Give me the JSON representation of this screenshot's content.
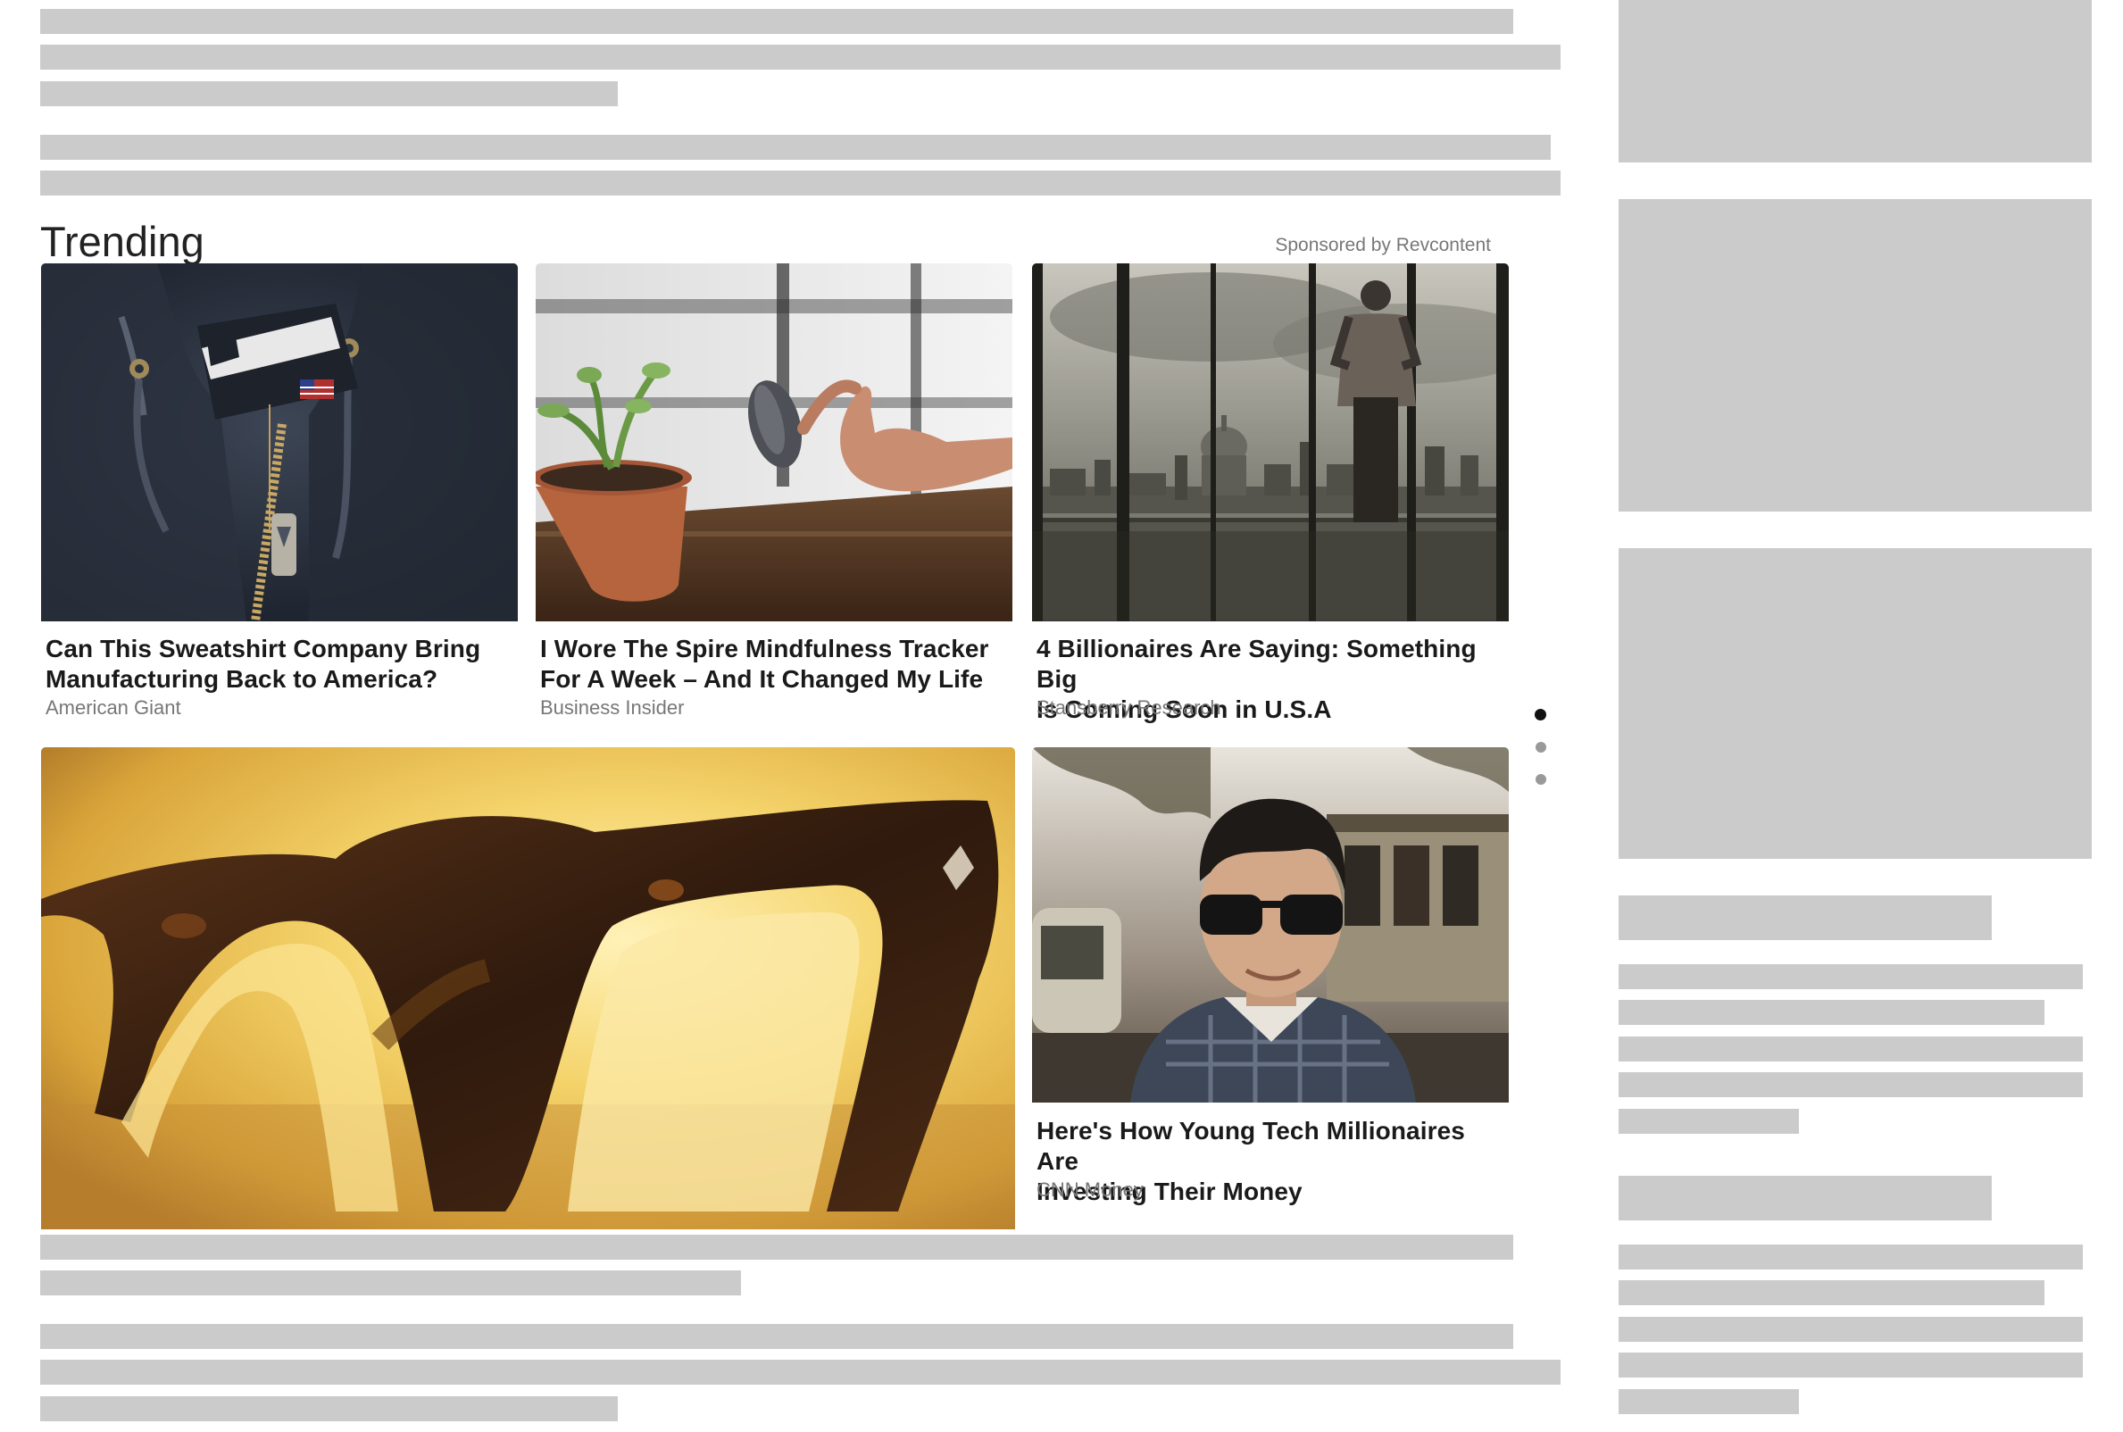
{
  "widget": {
    "title": "Trending",
    "sponsored_label": "Sponsored by Revcontent"
  },
  "cards": [
    {
      "headline_line1": "Can This Sweatshirt Company Bring",
      "headline_line2": "Manufacturing Back to America?",
      "source": "American Giant",
      "image": "sweatshirt-photo"
    },
    {
      "headline_line1": "I Wore The Spire Mindfulness Tracker",
      "headline_line2": "For A Week – And It Changed My Life",
      "source": "Business Insider",
      "image": "tracker-photo"
    },
    {
      "headline_line1": "4 Billionaires Are Saying: Something Big",
      "headline_line2": "Is Coming Soon in U.S.A",
      "source": "Stansberry Research",
      "image": "city-skyline-photo"
    },
    {
      "headline_line1": "",
      "headline_line2": "",
      "source": "",
      "image": "glasses-photo"
    },
    {
      "headline_line1": "Here's How Young Tech Millionaires Are",
      "headline_line2": "Investing Their Money",
      "source": "CNN Money",
      "image": "man-sunglasses-photo"
    }
  ],
  "pagination": {
    "pages": 3,
    "active": 1,
    "active_color": "#111111",
    "inactive_color": "#999999"
  },
  "colors": {
    "placeholder": "#cbcbcb",
    "headline": "#1a1a1a",
    "source": "#777777"
  }
}
